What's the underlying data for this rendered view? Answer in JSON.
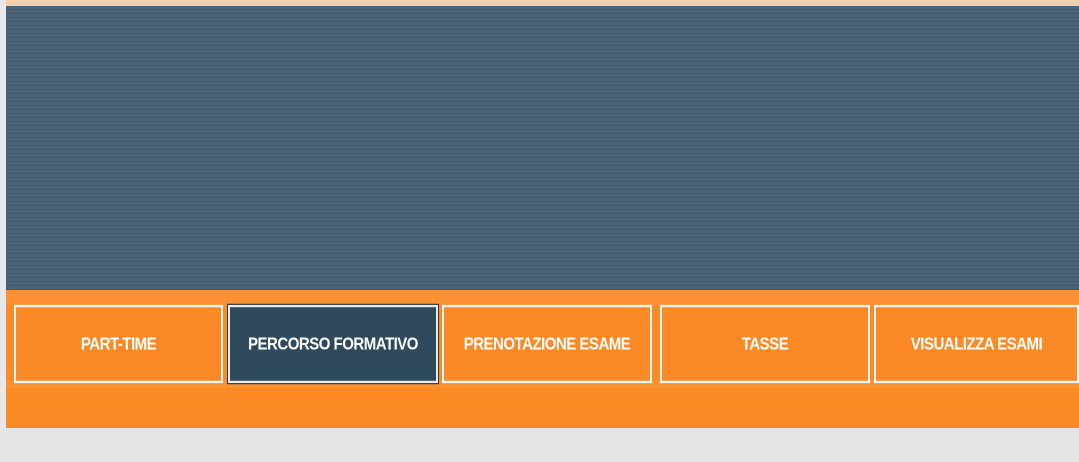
{
  "nav": {
    "tabs": [
      {
        "label": "PART-TIME",
        "active": false
      },
      {
        "label": "PERCORSO FORMATIVO",
        "active": true
      },
      {
        "label": "PRENOTAZIONE ESAME",
        "active": false
      },
      {
        "label": "TASSE",
        "active": false
      },
      {
        "label": "VISUALIZZA ESAMI",
        "active": false
      }
    ]
  },
  "colors": {
    "banner": "#4a6478",
    "nav_background": "#f98a24",
    "active_tab": "#304a5d",
    "tab_border": "#f8f8f8",
    "footer": "#e5e5e5"
  }
}
